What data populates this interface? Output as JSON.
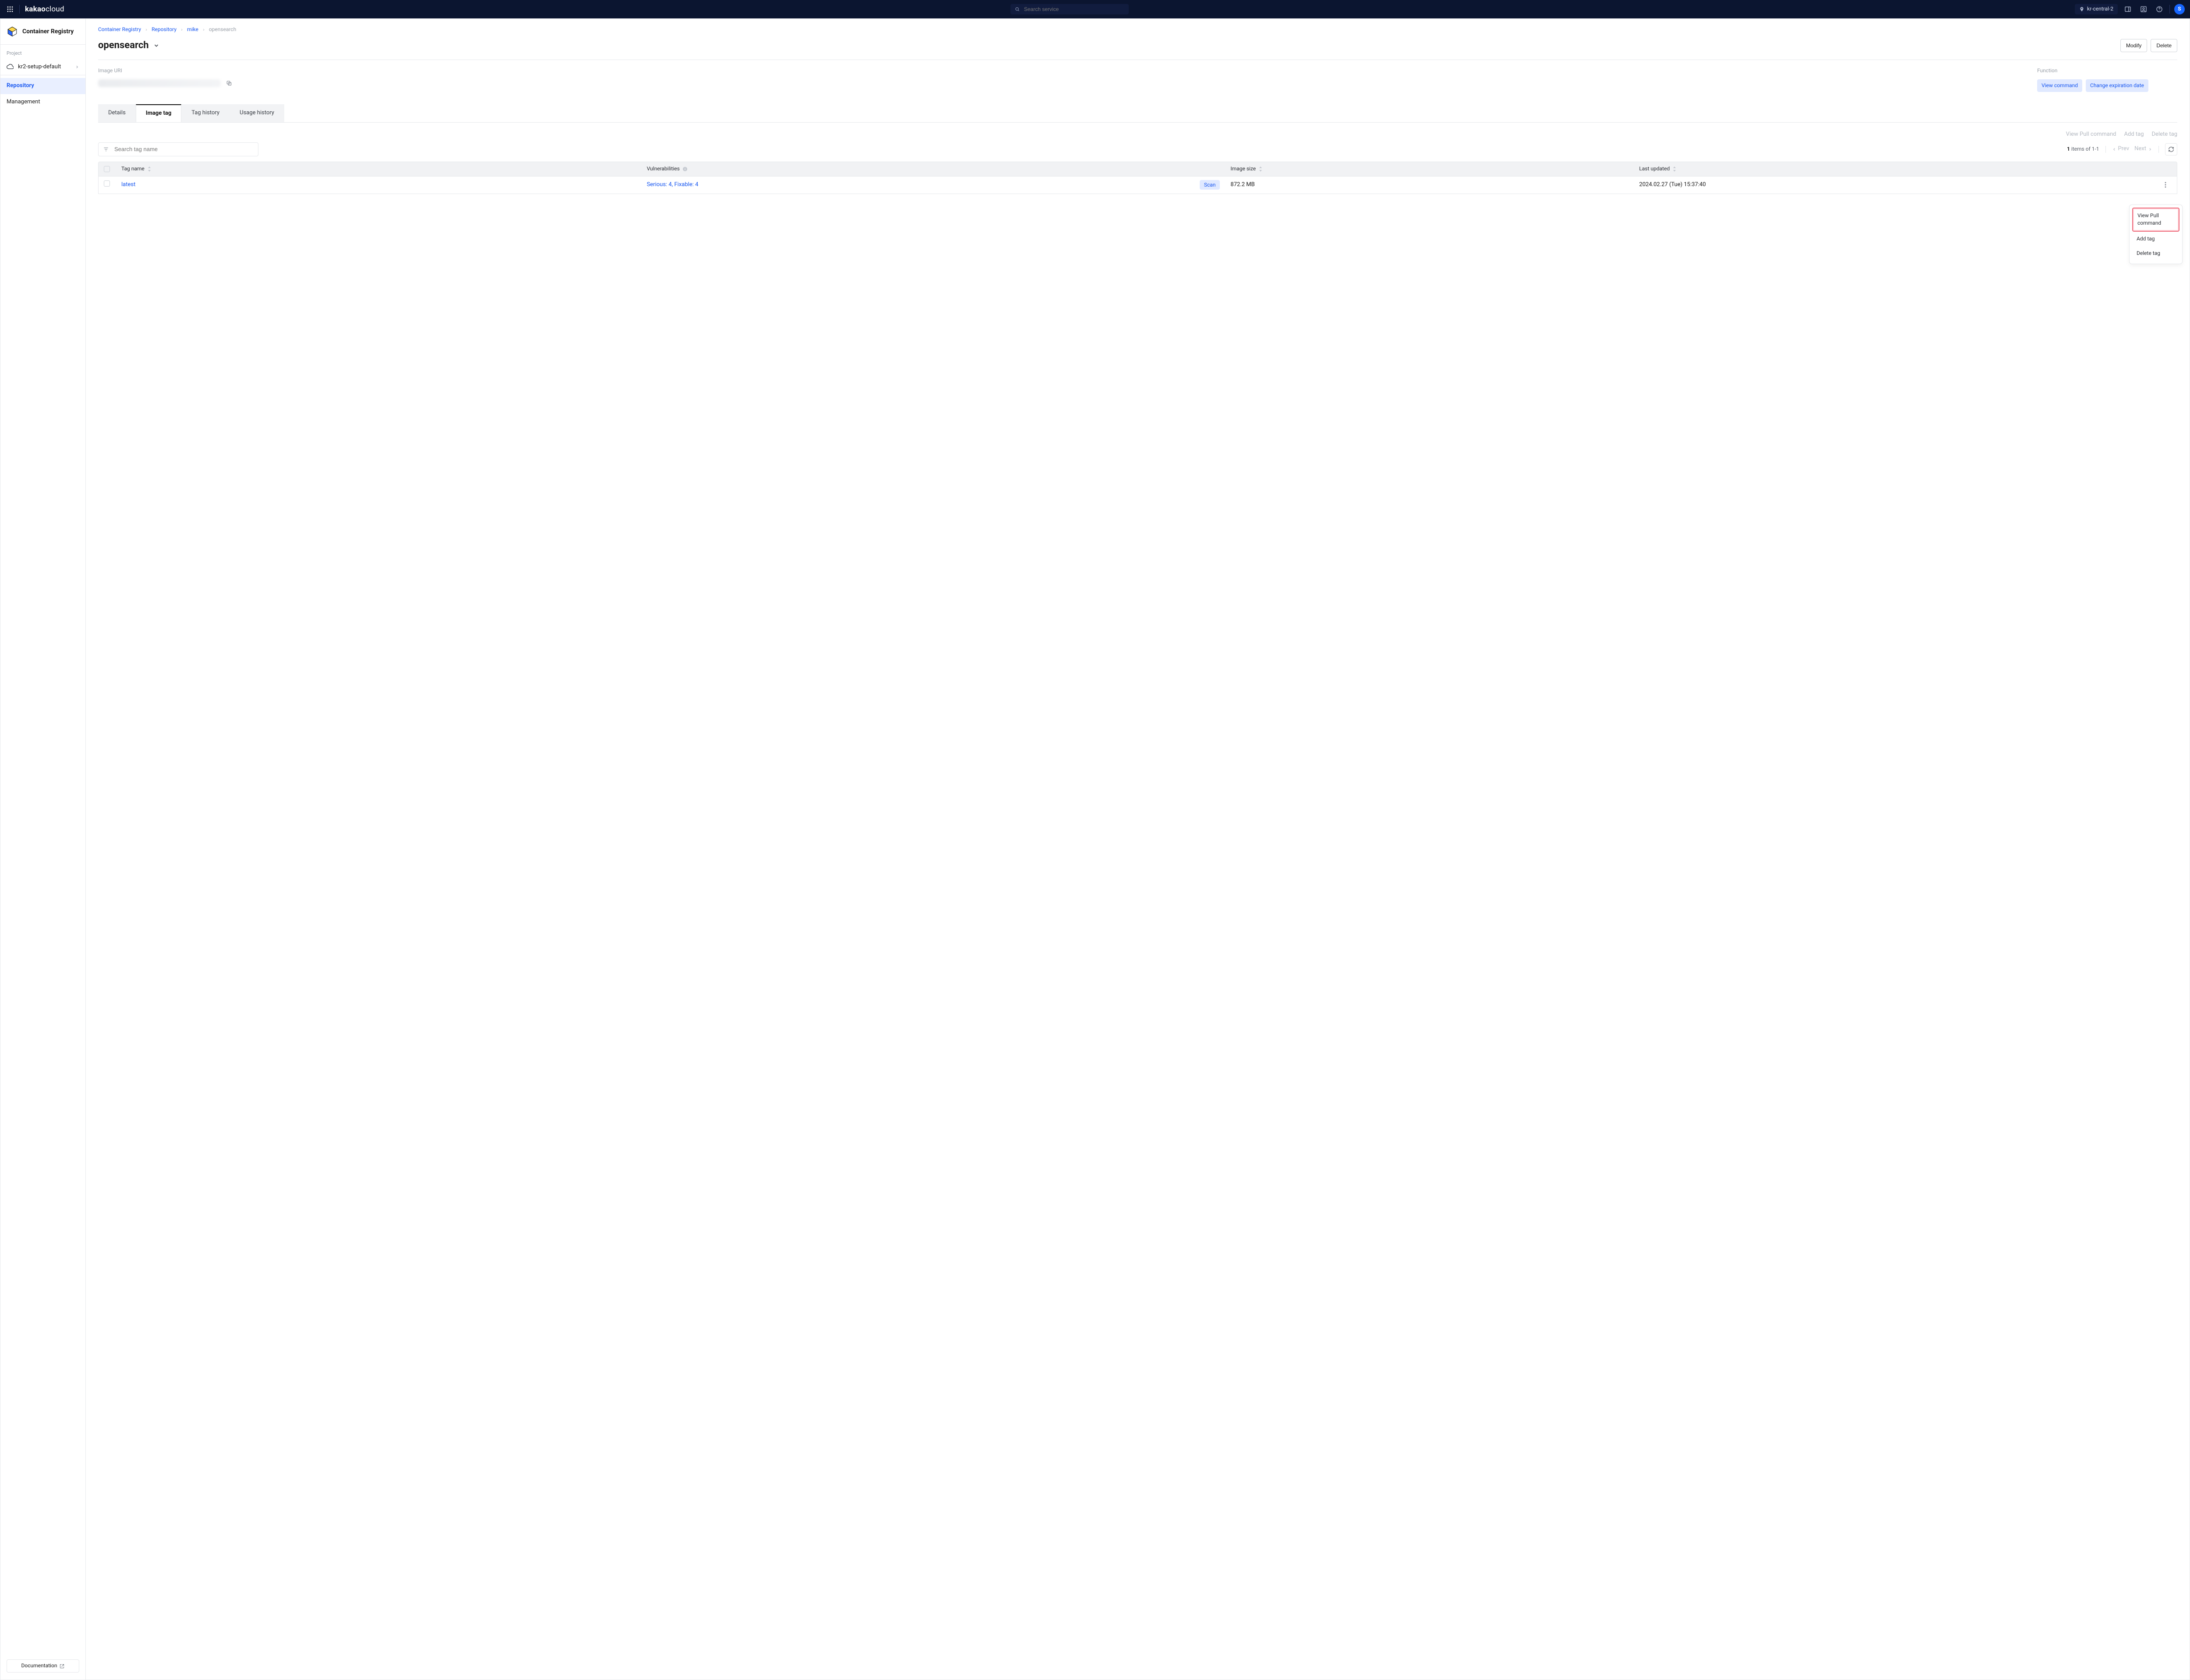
{
  "brand": {
    "bold": "kakao",
    "light": "cloud"
  },
  "search": {
    "placeholder": "Search service"
  },
  "region": {
    "label": "kr-central-2"
  },
  "avatar": {
    "initial": "S"
  },
  "sidebar": {
    "title": "Container Registry",
    "project_label": "Project",
    "project_name": "kr2-setup-default",
    "items": [
      {
        "label": "Repository",
        "active": true
      },
      {
        "label": "Management",
        "active": false
      }
    ],
    "doc_label": "Documentation"
  },
  "crumbs": [
    "Container Registry",
    "Repository",
    "mike",
    "opensearch"
  ],
  "page": {
    "title": "opensearch",
    "actions": {
      "modify": "Modify",
      "delete": "Delete"
    },
    "image_uri_label": "Image URI",
    "function_label": "Function",
    "badges": {
      "view_command": "View command",
      "change_expiration": "Change expiration date"
    }
  },
  "tabs": [
    "Details",
    "Image tag",
    "Tag history",
    "Usage history"
  ],
  "active_tab": 1,
  "toolbar": {
    "view_pull": "View Pull command",
    "add_tag": "Add tag",
    "delete_tag": "Delete tag"
  },
  "tag_search_placeholder": "Search tag name",
  "summary": {
    "count": "1",
    "text": " items of 1-1"
  },
  "pager": {
    "prev": "Prev",
    "next": "Next"
  },
  "columns": {
    "tag": "Tag name",
    "vuln": "Vulnerabilities",
    "size": "Image size",
    "updated": "Last updated"
  },
  "rows": [
    {
      "tag": "latest",
      "vuln": "Serious: 4, Fixable: 4",
      "scan": "Scan",
      "size": "872.2 MB",
      "updated": "2024.02.27 (Tue) 15:37:40"
    }
  ],
  "menu": {
    "view_pull": "View Pull command",
    "add_tag": "Add tag",
    "delete_tag": "Delete tag"
  }
}
